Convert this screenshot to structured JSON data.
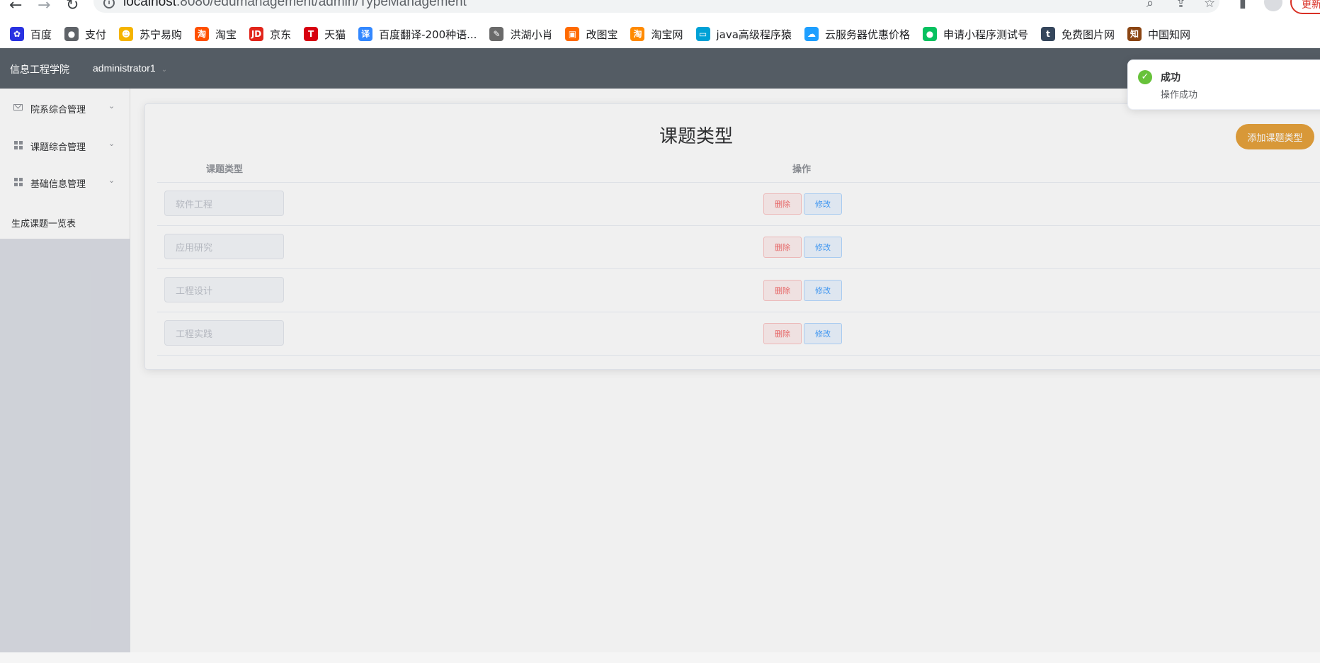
{
  "browser": {
    "url_host": "localhost",
    "url_path": ":8080/edumanagement/admin/TypeManagement",
    "update_label": "更新"
  },
  "bookmarks": [
    {
      "label": "百度",
      "icon": "baidu-paw-icon",
      "color": "#2932e1",
      "glyph": "✿"
    },
    {
      "label": "支付",
      "icon": "pay-icon",
      "color": "#5f6368",
      "glyph": "●"
    },
    {
      "label": "苏宁易购",
      "icon": "suning-lion-icon",
      "color": "#f5b400",
      "glyph": "☻"
    },
    {
      "label": "淘宝",
      "icon": "taobao-icon",
      "color": "#ff5000",
      "glyph": "淘"
    },
    {
      "label": "京东",
      "icon": "jd-icon",
      "color": "#e1251b",
      "glyph": "JD"
    },
    {
      "label": "天猫",
      "icon": "tmall-icon",
      "color": "#d7000f",
      "glyph": "T"
    },
    {
      "label": "百度翻译-200种语...",
      "icon": "translate-icon",
      "color": "#3388ff",
      "glyph": "译"
    },
    {
      "label": "洪湖小肖",
      "icon": "feather-icon",
      "color": "#6a6a6a",
      "glyph": "✎"
    },
    {
      "label": "改图宝",
      "icon": "gaitubao-icon",
      "color": "#ff6a00",
      "glyph": "▣"
    },
    {
      "label": "淘宝网",
      "icon": "taobao-icon",
      "color": "#ff8a00",
      "glyph": "淘"
    },
    {
      "label": "java高级程序猿",
      "icon": "bilibili-tv-icon",
      "color": "#00a1d6",
      "glyph": "▭"
    },
    {
      "label": "云服务器优惠价格",
      "icon": "cloud-icon",
      "color": "#1e9fff",
      "glyph": "☁"
    },
    {
      "label": "申请小程序测试号",
      "icon": "wechat-icon",
      "color": "#07c160",
      "glyph": "●"
    },
    {
      "label": "免费图片网",
      "icon": "tumblr-icon",
      "color": "#35465c",
      "glyph": "t"
    },
    {
      "label": "中国知网",
      "icon": "cnki-icon",
      "color": "#8b4513",
      "glyph": "知"
    }
  ],
  "header": {
    "brand": "信息工程学院",
    "user": "administrator1"
  },
  "sidebar": {
    "items": [
      {
        "label": "院系综合管理",
        "icon": "envelope-icon"
      },
      {
        "label": "课题综合管理",
        "icon": "grid-icon"
      },
      {
        "label": "基础信息管理",
        "icon": "grid-icon"
      }
    ],
    "plain_item": "生成课题一览表"
  },
  "main": {
    "title": "课题类型",
    "add_button": "添加课题类型",
    "columns": [
      "课题类型",
      "操作"
    ],
    "rows": [
      {
        "type": "软件工程"
      },
      {
        "type": "应用研究"
      },
      {
        "type": "工程设计"
      },
      {
        "type": "工程实践"
      }
    ],
    "delete_label": "删除",
    "edit_label": "修改"
  },
  "toast": {
    "title": "成功",
    "message": "操作成功",
    "color": "#67c23a"
  }
}
